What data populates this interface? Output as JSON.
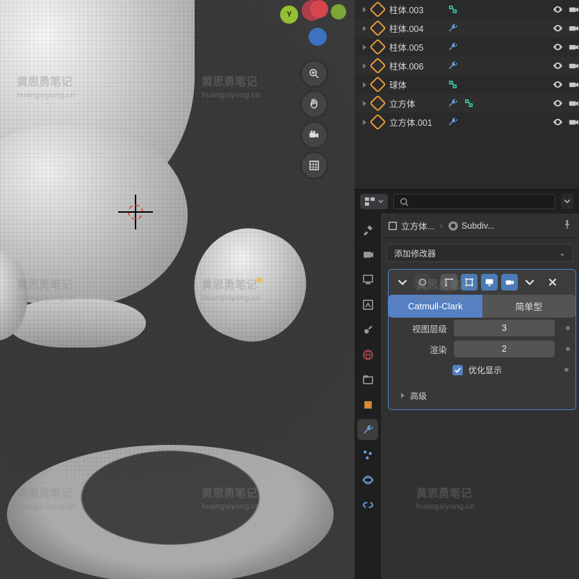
{
  "watermark": {
    "line1": "黄思勇笔记",
    "line2": "huangsiyong.cn"
  },
  "outliner": {
    "items": [
      {
        "name": "柱体.003",
        "wrench": false,
        "vgroup": true
      },
      {
        "name": "柱体.004",
        "wrench": true,
        "vgroup": false
      },
      {
        "name": "柱体.005",
        "wrench": true,
        "vgroup": false
      },
      {
        "name": "柱体.006",
        "wrench": true,
        "vgroup": false
      },
      {
        "name": "球体",
        "wrench": false,
        "vgroup": true
      },
      {
        "name": "立方体",
        "wrench": true,
        "vgroup": true
      },
      {
        "name": "立方体.001",
        "wrench": true,
        "vgroup": false
      }
    ]
  },
  "props_header": {
    "search_placeholder": ""
  },
  "breadcrumb": {
    "object": "立方体...",
    "modifier": "Subdiv..."
  },
  "add_modifier_label": "添加修改器",
  "modifier": {
    "name": "",
    "type": {
      "catmull": "Catmull-Clark",
      "simple": "简单型"
    },
    "viewport_label": "视图层级",
    "viewport_value": "3",
    "render_label": "渲染",
    "render_value": "2",
    "optimize_label": "优化显示",
    "advanced_label": "高级"
  },
  "gizmo": {
    "y": "Y"
  }
}
